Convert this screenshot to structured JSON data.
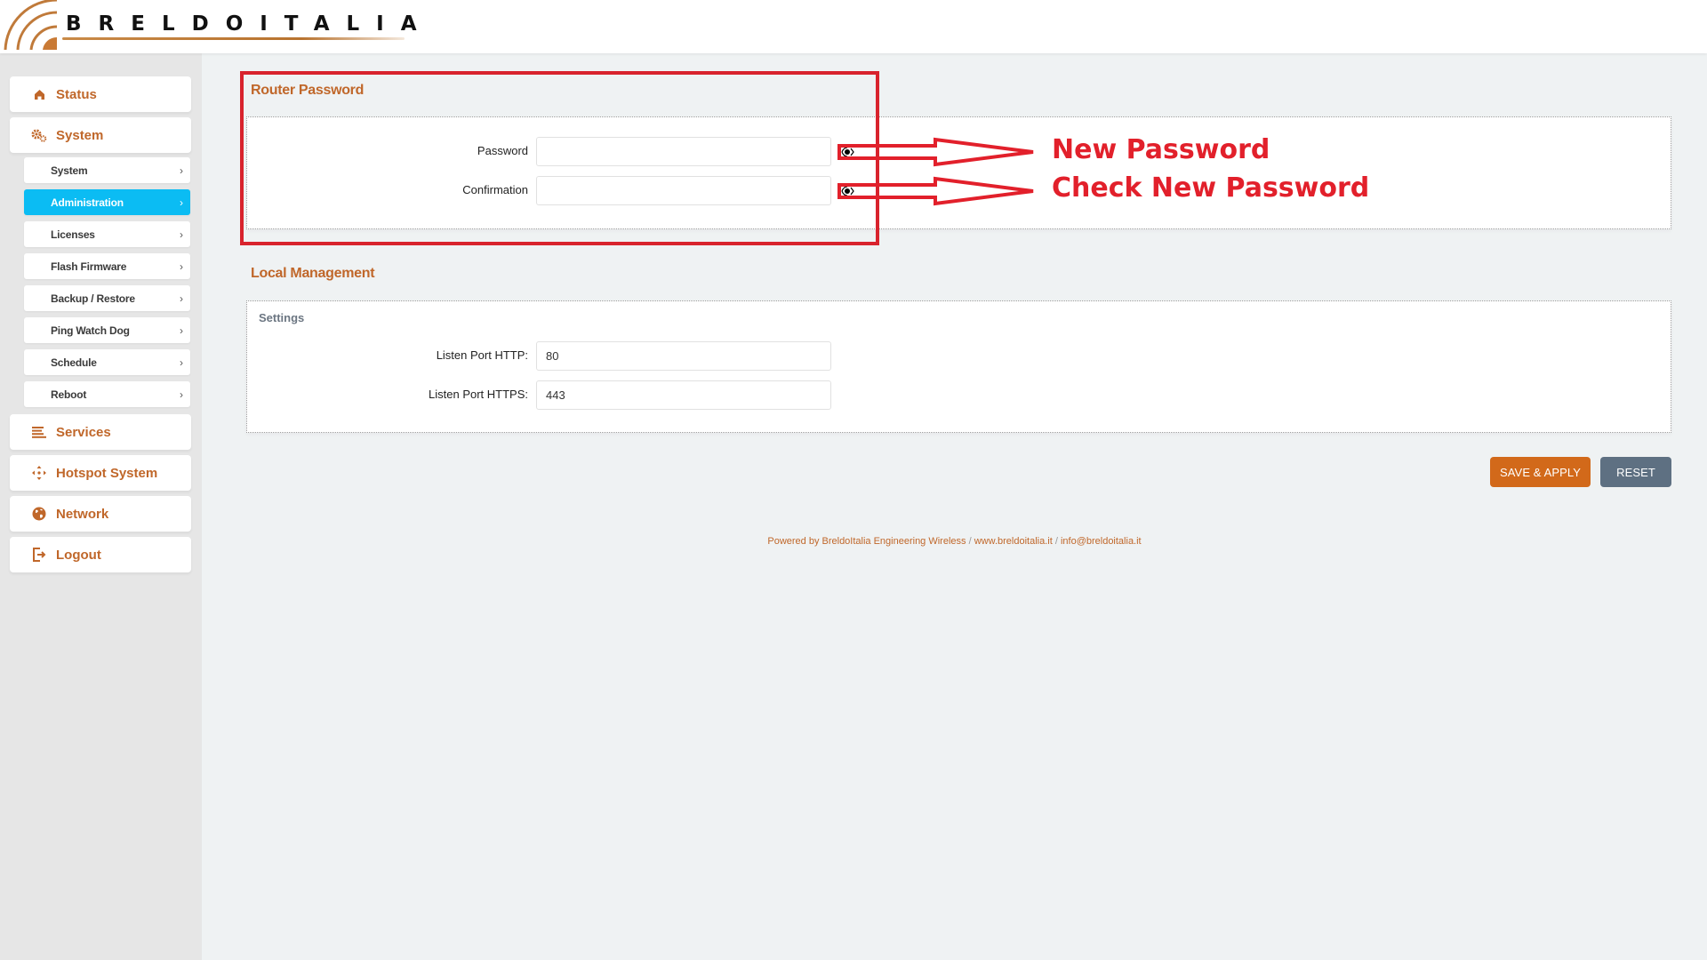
{
  "header": {
    "brand": "BRELDOITALIA",
    "logo_icon": "wifi-arcs-logo"
  },
  "sidebar": {
    "main_items": [
      {
        "label": "Status",
        "icon": "home-icon"
      },
      {
        "label": "System",
        "icon": "gears-icon"
      },
      {
        "label": "Services",
        "icon": "list-icon"
      },
      {
        "label": "Hotspot System",
        "icon": "move-arrows-icon"
      },
      {
        "label": "Network",
        "icon": "globe-icon"
      },
      {
        "label": "Logout",
        "icon": "logout-icon"
      }
    ],
    "sub_items": [
      {
        "label": "System",
        "chevron": "›"
      },
      {
        "label": "Administration",
        "chevron": "›",
        "active": true
      },
      {
        "label": "Licenses",
        "chevron": "›"
      },
      {
        "label": "Flash Firmware",
        "chevron": "›"
      },
      {
        "label": "Backup / Restore",
        "chevron": "›"
      },
      {
        "label": "Ping Watch Dog",
        "chevron": "›"
      },
      {
        "label": "Schedule",
        "chevron": "›"
      },
      {
        "label": "Reboot",
        "chevron": "›"
      }
    ],
    "active_color": "#0bbcf3"
  },
  "router_password": {
    "title": "Router Password",
    "fields": [
      {
        "label": "Password",
        "value": "",
        "reveal_icon": "eye-icon"
      },
      {
        "label": "Confirmation",
        "value": "",
        "reveal_icon": "eye-icon"
      }
    ]
  },
  "local_management": {
    "title": "Local Management",
    "subtitle": "Settings",
    "fields": [
      {
        "label": "Listen Port HTTP:",
        "value": "80"
      },
      {
        "label": "Listen Port HTTPS:",
        "value": "443"
      }
    ]
  },
  "actions": {
    "save_apply": "SAVE & APPLY",
    "reset": "RESET"
  },
  "footer": {
    "powered_by": "Powered by BreldoItalia Engineering Wireless",
    "separator": "/",
    "website": "www.breldoitalia.it",
    "email": "info@breldoitalia.it"
  },
  "annotations": {
    "new_password": "New Password",
    "check_new_password": "Check New Password",
    "color": "#e2202b"
  },
  "colors": {
    "brand_orange": "#c0672a",
    "save_button": "#d2691a",
    "reset_button": "#5e7082"
  }
}
